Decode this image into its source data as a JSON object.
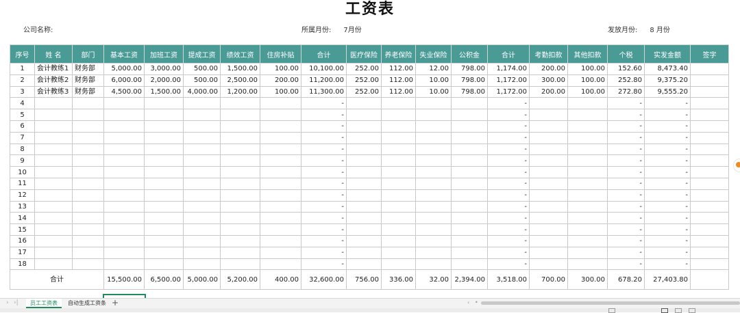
{
  "title": "工资表",
  "meta": {
    "company_label": "公司名称:",
    "belong_month_label": "所属月份:",
    "belong_month_value": "7月份",
    "pay_month_label": "发放月份:",
    "pay_month_value": "8 月份"
  },
  "columns": [
    "序号",
    "姓 名",
    "部门",
    "基本工资",
    "加班工资",
    "提成工资",
    "绩效工资",
    "住房补贴",
    "合计",
    "医疗保险",
    "养老保险",
    "失业保险",
    "公积金",
    "合计",
    "考勤扣款",
    "其他扣款",
    "个税",
    "实发金额",
    "签字"
  ],
  "rows": [
    [
      "1",
      "会计教练1",
      "财务部",
      "5,000.00",
      "3,000.00",
      "500.00",
      "1,500.00",
      "100.00",
      "10,100.00",
      "252.00",
      "112.00",
      "12.00",
      "798.00",
      "1,174.00",
      "200.00",
      "100.00",
      "152.60",
      "8,473.40",
      ""
    ],
    [
      "2",
      "会计教练2",
      "财务部",
      "6,000.00",
      "2,000.00",
      "500.00",
      "2,500.00",
      "200.00",
      "11,200.00",
      "252.00",
      "112.00",
      "10.00",
      "798.00",
      "1,172.00",
      "300.00",
      "100.00",
      "252.80",
      "9,375.20",
      ""
    ],
    [
      "3",
      "会计教练3",
      "财务部",
      "4,500.00",
      "1,500.00",
      "4,000.00",
      "1,200.00",
      "100.00",
      "11,300.00",
      "252.00",
      "112.00",
      "10.00",
      "798.00",
      "1,172.00",
      "200.00",
      "100.00",
      "272.80",
      "9,555.20",
      ""
    ],
    [
      "4",
      "",
      "",
      "",
      "",
      "",
      "",
      "",
      "-",
      "",
      "",
      "",
      "",
      "-",
      "",
      "",
      "-",
      "-",
      ""
    ],
    [
      "5",
      "",
      "",
      "",
      "",
      "",
      "",
      "",
      "-",
      "",
      "",
      "",
      "",
      "-",
      "",
      "",
      "-",
      "-",
      ""
    ],
    [
      "6",
      "",
      "",
      "",
      "",
      "",
      "",
      "",
      "-",
      "",
      "",
      "",
      "",
      "-",
      "",
      "",
      "-",
      "-",
      ""
    ],
    [
      "7",
      "",
      "",
      "",
      "",
      "",
      "",
      "",
      "-",
      "",
      "",
      "",
      "",
      "-",
      "",
      "",
      "-",
      "-",
      ""
    ],
    [
      "8",
      "",
      "",
      "",
      "",
      "",
      "",
      "",
      "-",
      "",
      "",
      "",
      "",
      "-",
      "",
      "",
      "-",
      "-",
      ""
    ],
    [
      "9",
      "",
      "",
      "",
      "",
      "",
      "",
      "",
      "-",
      "",
      "",
      "",
      "",
      "-",
      "",
      "",
      "-",
      "-",
      ""
    ],
    [
      "10",
      "",
      "",
      "",
      "",
      "",
      "",
      "",
      "-",
      "",
      "",
      "",
      "",
      "-",
      "",
      "",
      "-",
      "-",
      ""
    ],
    [
      "11",
      "",
      "",
      "",
      "",
      "",
      "",
      "",
      "-",
      "",
      "",
      "",
      "",
      "-",
      "",
      "",
      "-",
      "-",
      ""
    ],
    [
      "12",
      "",
      "",
      "",
      "",
      "",
      "",
      "",
      "-",
      "",
      "",
      "",
      "",
      "-",
      "",
      "",
      "-",
      "-",
      ""
    ],
    [
      "13",
      "",
      "",
      "",
      "",
      "",
      "",
      "",
      "-",
      "",
      "",
      "",
      "",
      "-",
      "",
      "",
      "-",
      "-",
      ""
    ],
    [
      "14",
      "",
      "",
      "",
      "",
      "",
      "",
      "",
      "-",
      "",
      "",
      "",
      "",
      "-",
      "",
      "",
      "-",
      "-",
      ""
    ],
    [
      "15",
      "",
      "",
      "",
      "",
      "",
      "",
      "",
      "-",
      "",
      "",
      "",
      "",
      "-",
      "",
      "",
      "-",
      "-",
      ""
    ],
    [
      "16",
      "",
      "",
      "",
      "",
      "",
      "",
      "",
      "-",
      "",
      "",
      "",
      "",
      "-",
      "",
      "",
      "-",
      "-",
      ""
    ],
    [
      "17",
      "",
      "",
      "",
      "",
      "",
      "",
      "",
      "-",
      "",
      "",
      "",
      "",
      "-",
      "",
      "",
      "-",
      "-",
      ""
    ],
    [
      "18",
      "",
      "",
      "",
      "",
      "",
      "",
      "",
      "-",
      "",
      "",
      "",
      "",
      "-",
      "",
      "",
      "-",
      "-",
      ""
    ]
  ],
  "totals": {
    "label": "合计",
    "values": [
      "15,500.00",
      "6,500.00",
      "5,000.00",
      "5,200.00",
      "400.00",
      "32,600.00",
      "756.00",
      "336.00",
      "32.00",
      "2,394.00",
      "3,518.00",
      "700.00",
      "300.00",
      "678.20",
      "27,403.80",
      ""
    ]
  },
  "sheet_tabs": [
    "员工工资表",
    "自动生成工资条"
  ],
  "colors": {
    "header_bg": "#4a9a96",
    "active_tab": "#1e8c5a"
  }
}
